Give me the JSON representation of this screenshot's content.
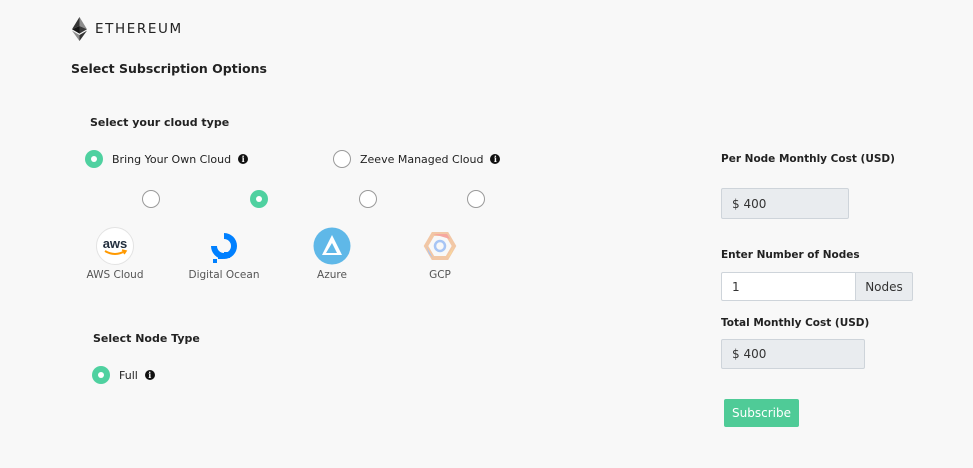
{
  "brand": {
    "name": "ETHEREUM"
  },
  "page_title": "Select Subscription Options",
  "cloud_section": {
    "title": "Select your cloud type",
    "options": [
      {
        "label": "Bring Your Own Cloud",
        "selected": true
      },
      {
        "label": "Zeeve Managed Cloud",
        "selected": false
      }
    ],
    "providers": [
      {
        "label": "AWS Cloud",
        "icon": "aws-icon",
        "selected": false
      },
      {
        "label": "Digital Ocean",
        "icon": "digital-ocean-icon",
        "selected": true
      },
      {
        "label": "Azure",
        "icon": "azure-icon",
        "selected": false
      },
      {
        "label": "GCP",
        "icon": "gcp-icon",
        "selected": false
      }
    ]
  },
  "node_section": {
    "title": "Select Node Type",
    "options": [
      {
        "label": "Full",
        "selected": true
      }
    ]
  },
  "pricing": {
    "per_node_label": "Per Node Monthly Cost (USD)",
    "per_node_value": "$ 400",
    "nodes_label": "Enter Number of Nodes",
    "nodes_value": "1",
    "nodes_addon": "Nodes",
    "total_label": "Total Monthly Cost (USD)",
    "total_value": "$ 400",
    "subscribe_label": "Subscribe"
  },
  "colors": {
    "accent": "#4fcb97",
    "background": "#f8f8f8"
  }
}
